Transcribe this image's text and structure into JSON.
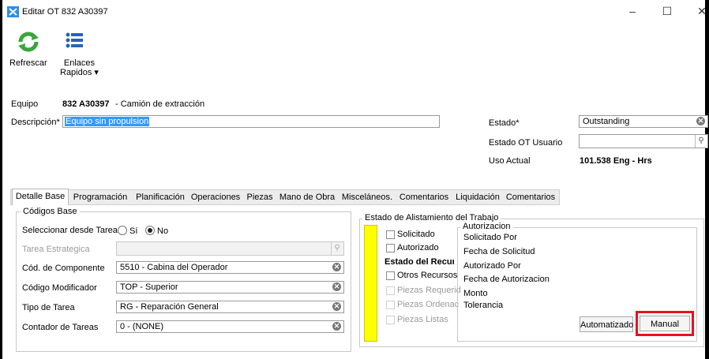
{
  "window": {
    "title": "Editar OT 832 A30397"
  },
  "toolbar": {
    "refresh_label": "Refrescar",
    "links_label": "Enlaces\nRapidos ▾"
  },
  "header": {
    "equipo_label": "Equipo",
    "equipo_value": "832 A30397",
    "equipo_desc": "- Camión de extracción",
    "descripcion_label": "Descripción*",
    "descripcion_value": "Equipo sin propulsion",
    "estado_label": "Estado*",
    "estado_value": "Outstanding",
    "estado_usuario_label": "Estado OT Usuario",
    "estado_usuario_value": "",
    "uso_label": "Uso Actual",
    "uso_value": "101.538 Eng - Hrs"
  },
  "tabs": [
    "Detalle Base",
    "Programación",
    "Planificación",
    "Operaciones",
    "Piezas",
    "Mano de Obra",
    "Misceláneos.",
    "Comentarios",
    "Liquidación",
    "Comentarios"
  ],
  "codigos": {
    "title": "Códigos Base",
    "seleccionar_label": "Seleccionar desde Tarea I",
    "si_label": "Sí",
    "no_label": "No",
    "tarea_label": "Tarea Estrategica",
    "tarea_value": "",
    "componente_label": "Cód. de Componente",
    "componente_value": "5510 - Cabina del Operador",
    "modificador_label": "Código Modificador",
    "modificador_value": "TOP - Superior",
    "tipo_label": "Tipo de Tarea",
    "tipo_value": "RG - Reparación General",
    "contador_label": "Contador de Tareas",
    "contador_value": "0 - (NONE)"
  },
  "estado_alistamiento": {
    "title": "Estado de Alistamiento del Trabajo",
    "solicitado": "Solicitado",
    "autorizado": "Autorizado",
    "estado_recursos": "Estado del Recurso",
    "otros_recursos": "Otros Recursos",
    "piezas_requeridas": "Piezas Requerid",
    "piezas_ordenadas": "Piezas Ordenac",
    "piezas_listas": "Piezas Listas"
  },
  "autorizacion": {
    "title": "Autorizacion",
    "solicitado_por": "Solicitado Por",
    "fecha_solicitud": "Fecha de Solicitud",
    "autorizado_por": "Autorizado Por",
    "fecha_autorizacion": "Fecha de Autorizacion",
    "monto": "Monto",
    "tolerancia": "Tolerancia",
    "automatizado_button": "Automatizado",
    "manual_button": "Manual"
  },
  "colors": {
    "accent": "#2a63b8",
    "highlight": "#e8121b",
    "status_bar": "#ffff00",
    "selection": "#3399ff"
  },
  "icons": {
    "refresh": "refresh-icon",
    "links": "list-icon",
    "app": "app-icon"
  }
}
